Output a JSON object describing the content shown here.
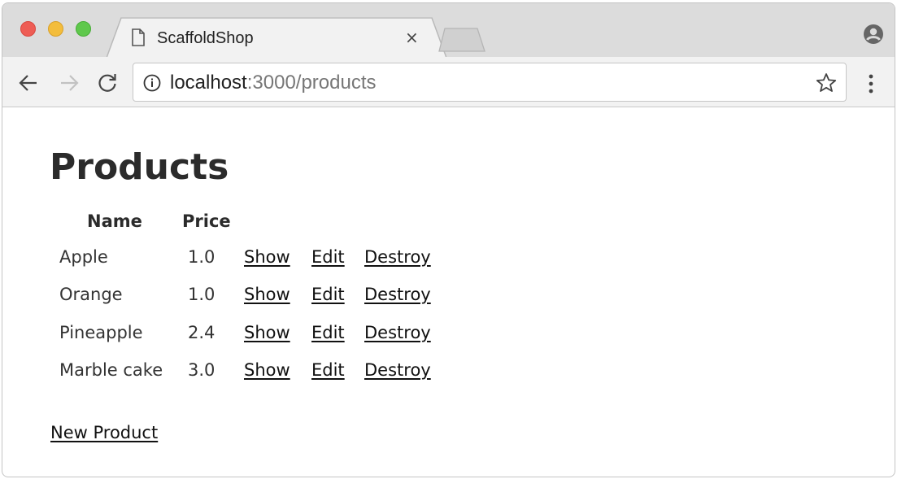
{
  "browser": {
    "tab_title": "ScaffoldShop",
    "tab_close": "×",
    "url_host": "localhost",
    "url_path": ":3000/products"
  },
  "page": {
    "heading": "Products",
    "columns": [
      "Name",
      "Price"
    ],
    "rows": [
      {
        "name": "Apple",
        "price": "1.0",
        "show": "Show",
        "edit": "Edit",
        "destroy": "Destroy"
      },
      {
        "name": "Orange",
        "price": "1.0",
        "show": "Show",
        "edit": "Edit",
        "destroy": "Destroy"
      },
      {
        "name": "Pineapple",
        "price": "2.4",
        "show": "Show",
        "edit": "Edit",
        "destroy": "Destroy"
      },
      {
        "name": "Marble cake",
        "price": "3.0",
        "show": "Show",
        "edit": "Edit",
        "destroy": "Destroy"
      }
    ],
    "new_link": "New Product"
  },
  "icons": {
    "back": "back-arrow-icon",
    "forward": "forward-arrow-icon",
    "reload": "reload-icon",
    "info": "info-icon",
    "star": "star-icon",
    "menu": "kebab-menu-icon",
    "profile": "profile-icon",
    "page": "page-icon"
  }
}
